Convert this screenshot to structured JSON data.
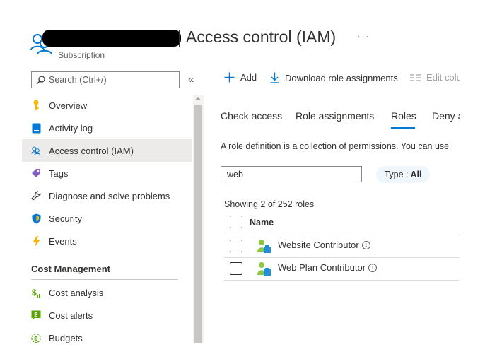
{
  "header": {
    "title": "Access control (IAM)",
    "subtitle": "Subscription",
    "more_glyph": "···",
    "icon": "users-icon"
  },
  "sidebar": {
    "search_placeholder": "Search (Ctrl+/)",
    "collapse_glyph": "«",
    "items": [
      {
        "label": "Overview",
        "icon": "key-icon"
      },
      {
        "label": "Activity log",
        "icon": "log-icon"
      },
      {
        "label": "Access control (IAM)",
        "icon": "users-icon",
        "active": true
      },
      {
        "label": "Tags",
        "icon": "tag-icon"
      },
      {
        "label": "Diagnose and solve problems",
        "icon": "wrench-icon"
      },
      {
        "label": "Security",
        "icon": "shield-icon"
      },
      {
        "label": "Events",
        "icon": "lightning-icon"
      }
    ],
    "section_title": "Cost Management",
    "section_items": [
      {
        "label": "Cost analysis",
        "icon": "dollar-chart-icon"
      },
      {
        "label": "Cost alerts",
        "icon": "dollar-alert-icon"
      },
      {
        "label": "Budgets",
        "icon": "budget-icon"
      }
    ]
  },
  "toolbar": {
    "add_label": "Add",
    "download_label": "Download role assignments",
    "edit_columns_label": "Edit colu"
  },
  "tabs": {
    "check_access": "Check access",
    "role_assignments": "Role assignments",
    "roles": "Roles",
    "deny": "Deny a",
    "selected": "Roles"
  },
  "roles_panel": {
    "description": "A role definition is a collection of permissions. You can use",
    "filter_value": "web",
    "type_filter_label": "Type :",
    "type_filter_value": "All",
    "count_text": "Showing 2 of 252 roles",
    "column_name": "Name",
    "rows": [
      {
        "name": "Website Contributor"
      },
      {
        "name": "Web Plan Contributor"
      }
    ]
  },
  "colors": {
    "accent": "#0078d4",
    "active_bg": "#edebe9",
    "pill_bg": "#eff6fc"
  }
}
